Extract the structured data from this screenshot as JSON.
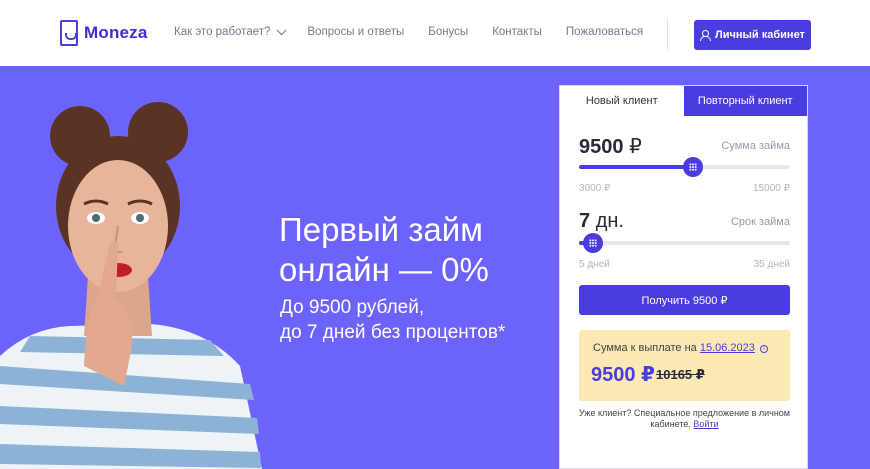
{
  "header": {
    "logo_text": "Moneza",
    "nav": [
      {
        "label": "Как это работает?"
      },
      {
        "label": "Вопросы и ответы"
      },
      {
        "label": "Бонусы"
      },
      {
        "label": "Контакты"
      },
      {
        "label": "Пожаловаться"
      }
    ],
    "cabinet_label": "Личный кабинет"
  },
  "hero": {
    "headline_line1": "Первый займ",
    "headline_line2": "онлайн — 0%",
    "sub_line1": "До 9500 рублей,",
    "sub_line2": "до 7 дней без процентов*"
  },
  "form": {
    "tab_new": "Новый клиент",
    "tab_repeat": "Повторный клиент",
    "amount_value": "9500",
    "amount_unit": "₽",
    "amount_label": "Сумма займа",
    "amount_min": "3000 ₽",
    "amount_max": "15000 ₽",
    "amount_fraction": 0.5417,
    "term_value": "7",
    "term_unit": "дн.",
    "term_label": "Срок займа",
    "term_min": "5 дней",
    "term_max": "35 дней",
    "term_fraction": 0.0667,
    "submit_label": "Получить 9500 ₽",
    "payout_label": "Сумма к выплате на",
    "payout_date": "15.06.2023",
    "payout_amount": "9500 ₽",
    "payout_old": "10165 ₽",
    "note_text": "Уже клиент? Специальное предложение в личном кабинете.",
    "note_link": "Войти"
  },
  "colors": {
    "brand": "#4a3de0",
    "hero_bg": "#6c63fc",
    "payout_bg": "#fae9b5"
  }
}
